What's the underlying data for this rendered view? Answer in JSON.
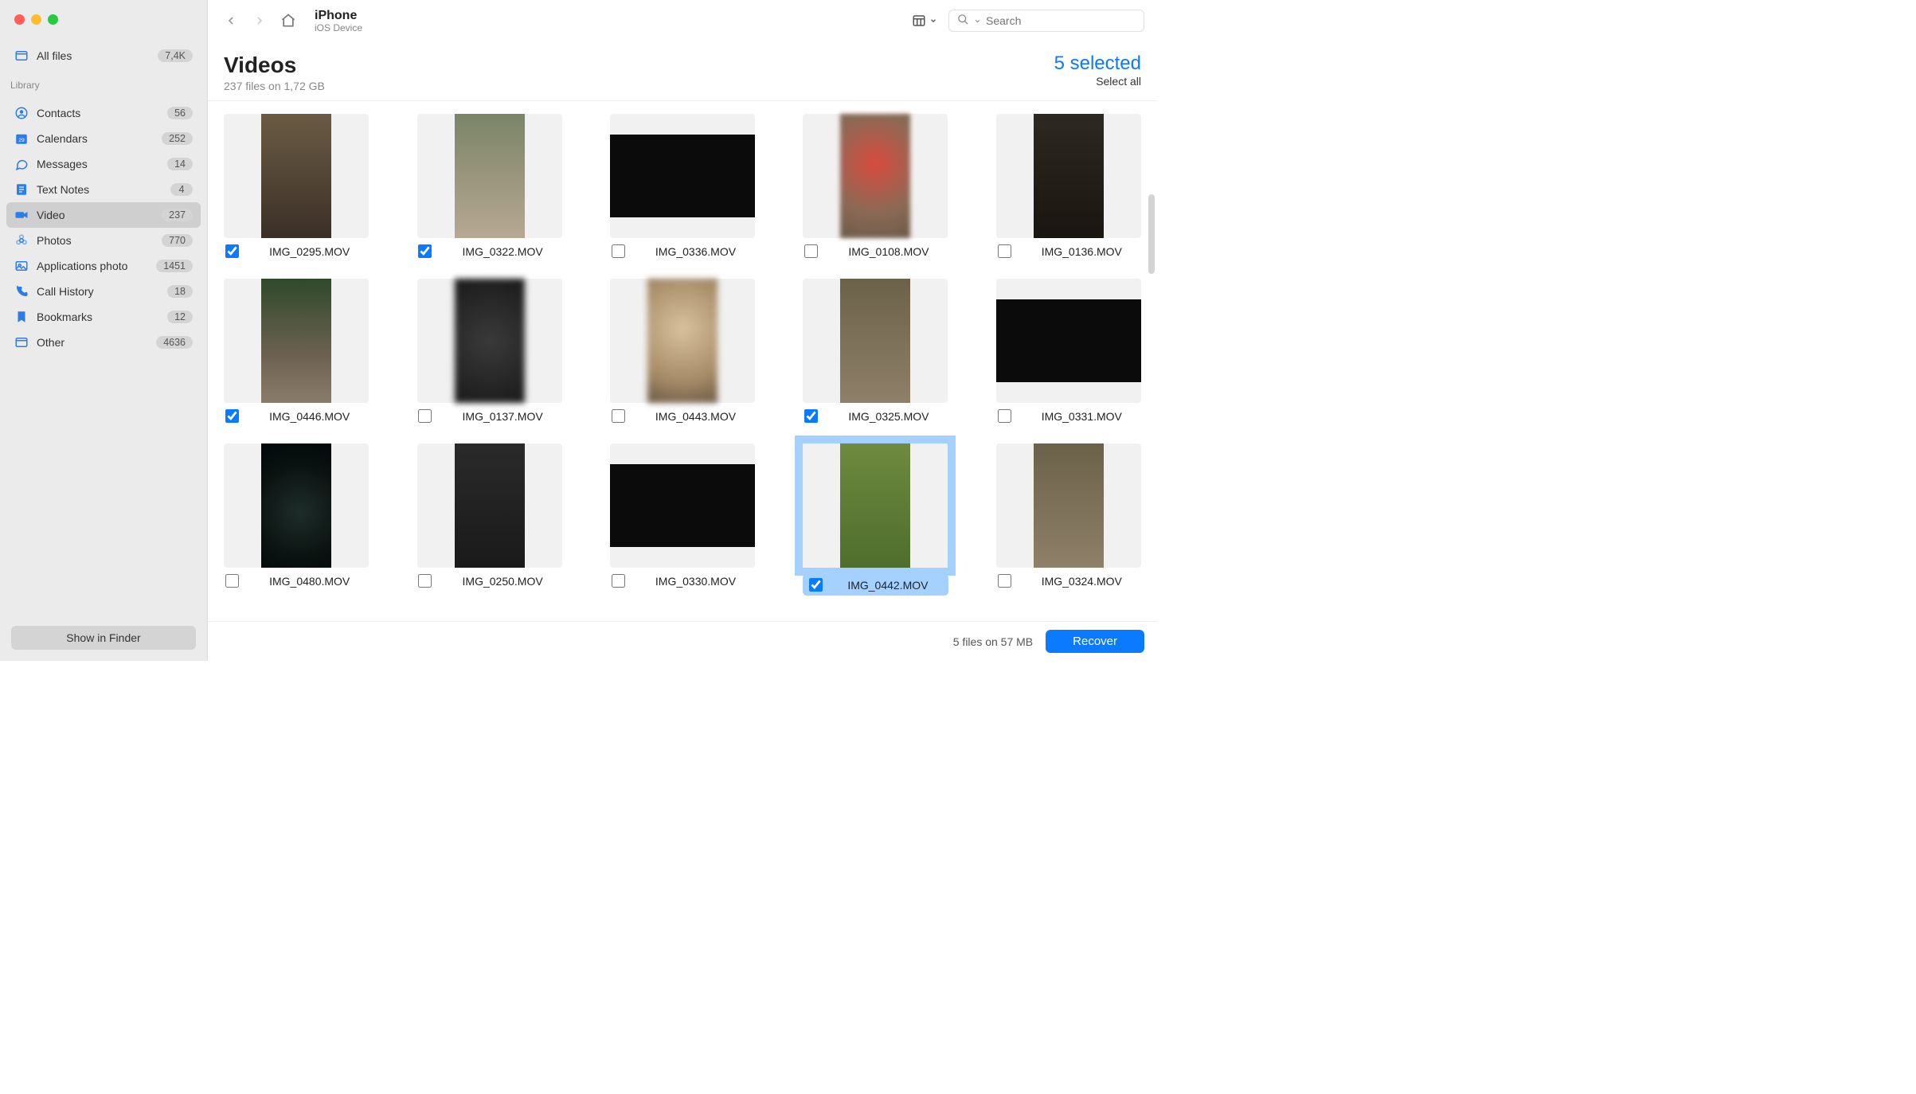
{
  "traffic_lights": {
    "close": "close",
    "min": "minimize",
    "max": "maximize"
  },
  "sidebar": {
    "all_files": {
      "label": "All files",
      "badge": "7,4K"
    },
    "section_header": "Library",
    "items": [
      {
        "icon": "contacts-icon",
        "label": "Contacts",
        "badge": "56",
        "active": false
      },
      {
        "icon": "calendars-icon",
        "label": "Calendars",
        "badge": "252",
        "active": false
      },
      {
        "icon": "messages-icon",
        "label": "Messages",
        "badge": "14",
        "active": false
      },
      {
        "icon": "textnotes-icon",
        "label": "Text Notes",
        "badge": "4",
        "active": false
      },
      {
        "icon": "video-icon",
        "label": "Video",
        "badge": "237",
        "active": true
      },
      {
        "icon": "photos-icon",
        "label": "Photos",
        "badge": "770",
        "active": false
      },
      {
        "icon": "appphoto-icon",
        "label": "Applications photo",
        "badge": "1451",
        "active": false
      },
      {
        "icon": "callhistory-icon",
        "label": "Call History",
        "badge": "18",
        "active": false
      },
      {
        "icon": "bookmarks-icon",
        "label": "Bookmarks",
        "badge": "12",
        "active": false
      },
      {
        "icon": "other-icon",
        "label": "Other",
        "badge": "4636",
        "active": false
      }
    ],
    "footer_button": "Show in Finder"
  },
  "toolbar": {
    "title": "iPhone",
    "subtitle": "iOS Device",
    "search_placeholder": "Search"
  },
  "header": {
    "heading": "Videos",
    "sub": "237 files on 1,72 GB",
    "selected_count": "5 selected",
    "select_all": "Select all"
  },
  "grid": {
    "items": [
      {
        "name": "IMG_0295.MOV",
        "checked": true,
        "highlighted": false,
        "shape": "portrait",
        "cls": "t-cat"
      },
      {
        "name": "IMG_0322.MOV",
        "checked": true,
        "highlighted": false,
        "shape": "portrait",
        "cls": "t-bed"
      },
      {
        "name": "IMG_0336.MOV",
        "checked": false,
        "highlighted": false,
        "shape": "wide",
        "cls": "t-black"
      },
      {
        "name": "IMG_0108.MOV",
        "checked": false,
        "highlighted": false,
        "shape": "portrait",
        "cls": "t-blur-red"
      },
      {
        "name": "IMG_0136.MOV",
        "checked": false,
        "highlighted": false,
        "shape": "portrait",
        "cls": "t-table"
      },
      {
        "name": "IMG_0446.MOV",
        "checked": true,
        "highlighted": false,
        "shape": "portrait",
        "cls": "t-forest-dog"
      },
      {
        "name": "IMG_0137.MOV",
        "checked": false,
        "highlighted": false,
        "shape": "portrait",
        "cls": "t-blur1"
      },
      {
        "name": "IMG_0443.MOV",
        "checked": false,
        "highlighted": false,
        "shape": "portrait",
        "cls": "t-blur-tan"
      },
      {
        "name": "IMG_0325.MOV",
        "checked": true,
        "highlighted": false,
        "shape": "portrait",
        "cls": "t-bed2"
      },
      {
        "name": "IMG_0331.MOV",
        "checked": false,
        "highlighted": false,
        "shape": "wide",
        "cls": "t-black"
      },
      {
        "name": "IMG_0480.MOV",
        "checked": false,
        "highlighted": false,
        "shape": "portrait",
        "cls": "t-dark-cat"
      },
      {
        "name": "IMG_0250.MOV",
        "checked": false,
        "highlighted": false,
        "shape": "portrait",
        "cls": "t-tv"
      },
      {
        "name": "IMG_0330.MOV",
        "checked": false,
        "highlighted": false,
        "shape": "wide",
        "cls": "t-black"
      },
      {
        "name": "IMG_0442.MOV",
        "checked": true,
        "highlighted": true,
        "shape": "portrait",
        "cls": "t-grass-dog"
      },
      {
        "name": "IMG_0324.MOV",
        "checked": false,
        "highlighted": false,
        "shape": "portrait",
        "cls": "t-bed2"
      }
    ]
  },
  "footer": {
    "summary": "5 files on 57 MB",
    "recover": "Recover"
  }
}
